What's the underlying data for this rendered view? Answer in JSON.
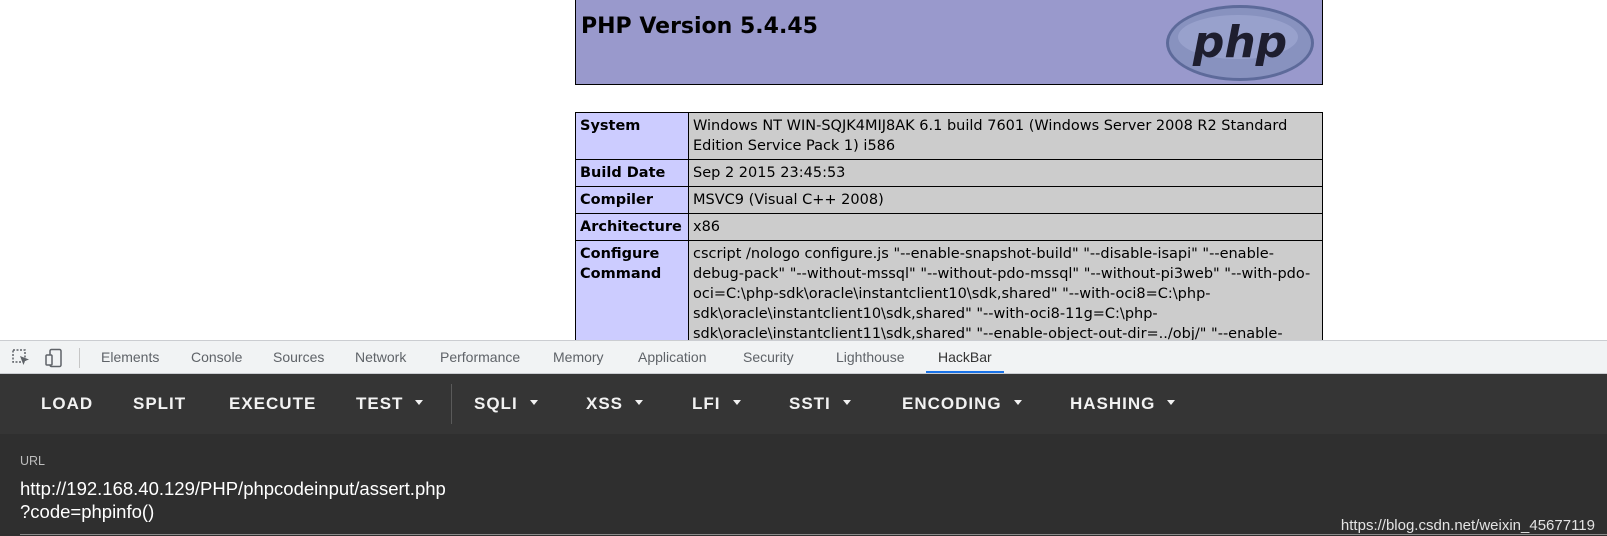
{
  "phpinfo": {
    "title": "PHP Version 5.4.45",
    "logo_text": "php",
    "rows": [
      {
        "key": "System",
        "value": "Windows NT WIN-SQJK4MIJ8AK 6.1 build 7601 (Windows Server 2008 R2 Standard Edition Service Pack 1) i586"
      },
      {
        "key": "Build Date",
        "value": "Sep 2 2015 23:45:53"
      },
      {
        "key": "Compiler",
        "value": "MSVC9 (Visual C++ 2008)"
      },
      {
        "key": "Architecture",
        "value": "x86"
      },
      {
        "key": "Configure Command",
        "value": "cscript /nologo configure.js \"--enable-snapshot-build\" \"--disable-isapi\" \"--enable-debug-pack\" \"--without-mssql\" \"--without-pdo-mssql\" \"--without-pi3web\" \"--with-pdo-oci=C:\\php-sdk\\oracle\\instantclient10\\sdk,shared\" \"--with-oci8=C:\\php-sdk\\oracle\\instantclient10\\sdk,shared\" \"--with-oci8-11g=C:\\php-sdk\\oracle\\instantclient11\\sdk,shared\" \"--enable-object-out-dir=../obj/\" \"--enable-"
      }
    ]
  },
  "devtools": {
    "icons": [
      "inspect-element-icon",
      "device-toolbar-icon"
    ],
    "tabs": [
      "Elements",
      "Console",
      "Sources",
      "Network",
      "Performance",
      "Memory",
      "Application",
      "Security",
      "Lighthouse",
      "HackBar"
    ],
    "active_tab": "HackBar"
  },
  "hackbar": {
    "buttons": {
      "load": "LOAD",
      "split": "SPLIT",
      "execute": "EXECUTE",
      "test": "TEST",
      "sqli": "SQLI",
      "xss": "XSS",
      "lfi": "LFI",
      "ssti": "SSTI",
      "encoding": "ENCODING",
      "hashing": "HASHING"
    },
    "url_label": "URL",
    "url_line1": "http://192.168.40.129/PHP/phpcodeinput/assert.php",
    "url_line2": "?code=phpinfo()",
    "watermark": "https://blog.csdn.net/weixin_45677119"
  },
  "colors": {
    "php_header": "#9999cc",
    "php_key_cell": "#ccccff",
    "php_value_cell": "#cccccc",
    "devtools_active": "#1a73e8",
    "hackbar_bg": "#353535"
  }
}
